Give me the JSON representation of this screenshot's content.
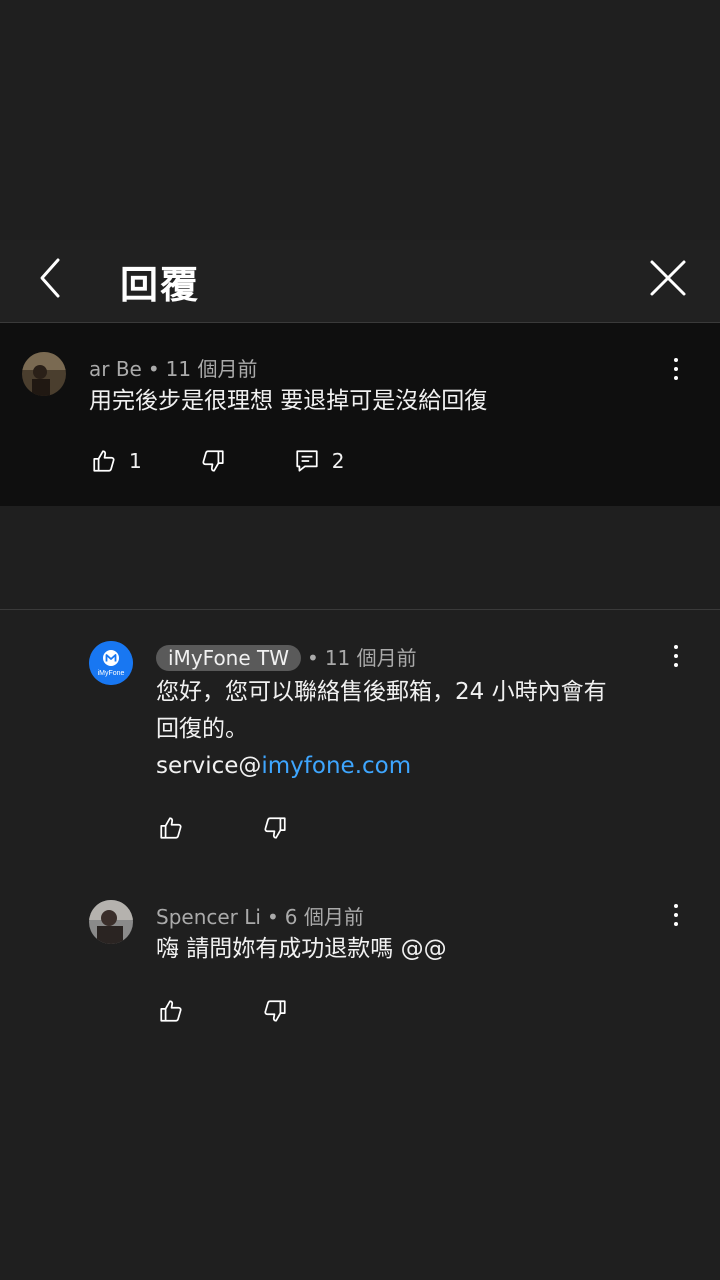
{
  "header": {
    "title": "回覆"
  },
  "parent_comment": {
    "author": "ar Be",
    "time": "11 個月前",
    "text": "用完後步是很理想 要退掉可是沒給回復",
    "likes": "1",
    "replies": "2"
  },
  "replies": [
    {
      "author": "iMyFone TW",
      "time": "11 個月前",
      "text_line1": "您好，您可以聯絡售後郵箱，24 小時內會有",
      "text_line2": "回復的。",
      "link_prefix": "service@",
      "link_text": "imyfone.com",
      "avatar_label": "iMyFone"
    },
    {
      "author": "Spencer Li",
      "time": "6 個月前",
      "text": "嗨 請問妳有成功退款嗎 @@"
    }
  ],
  "colors": {
    "accent_link": "#3ea6ff",
    "brand_blue": "#1877f2",
    "background": "#1f1f1f"
  }
}
